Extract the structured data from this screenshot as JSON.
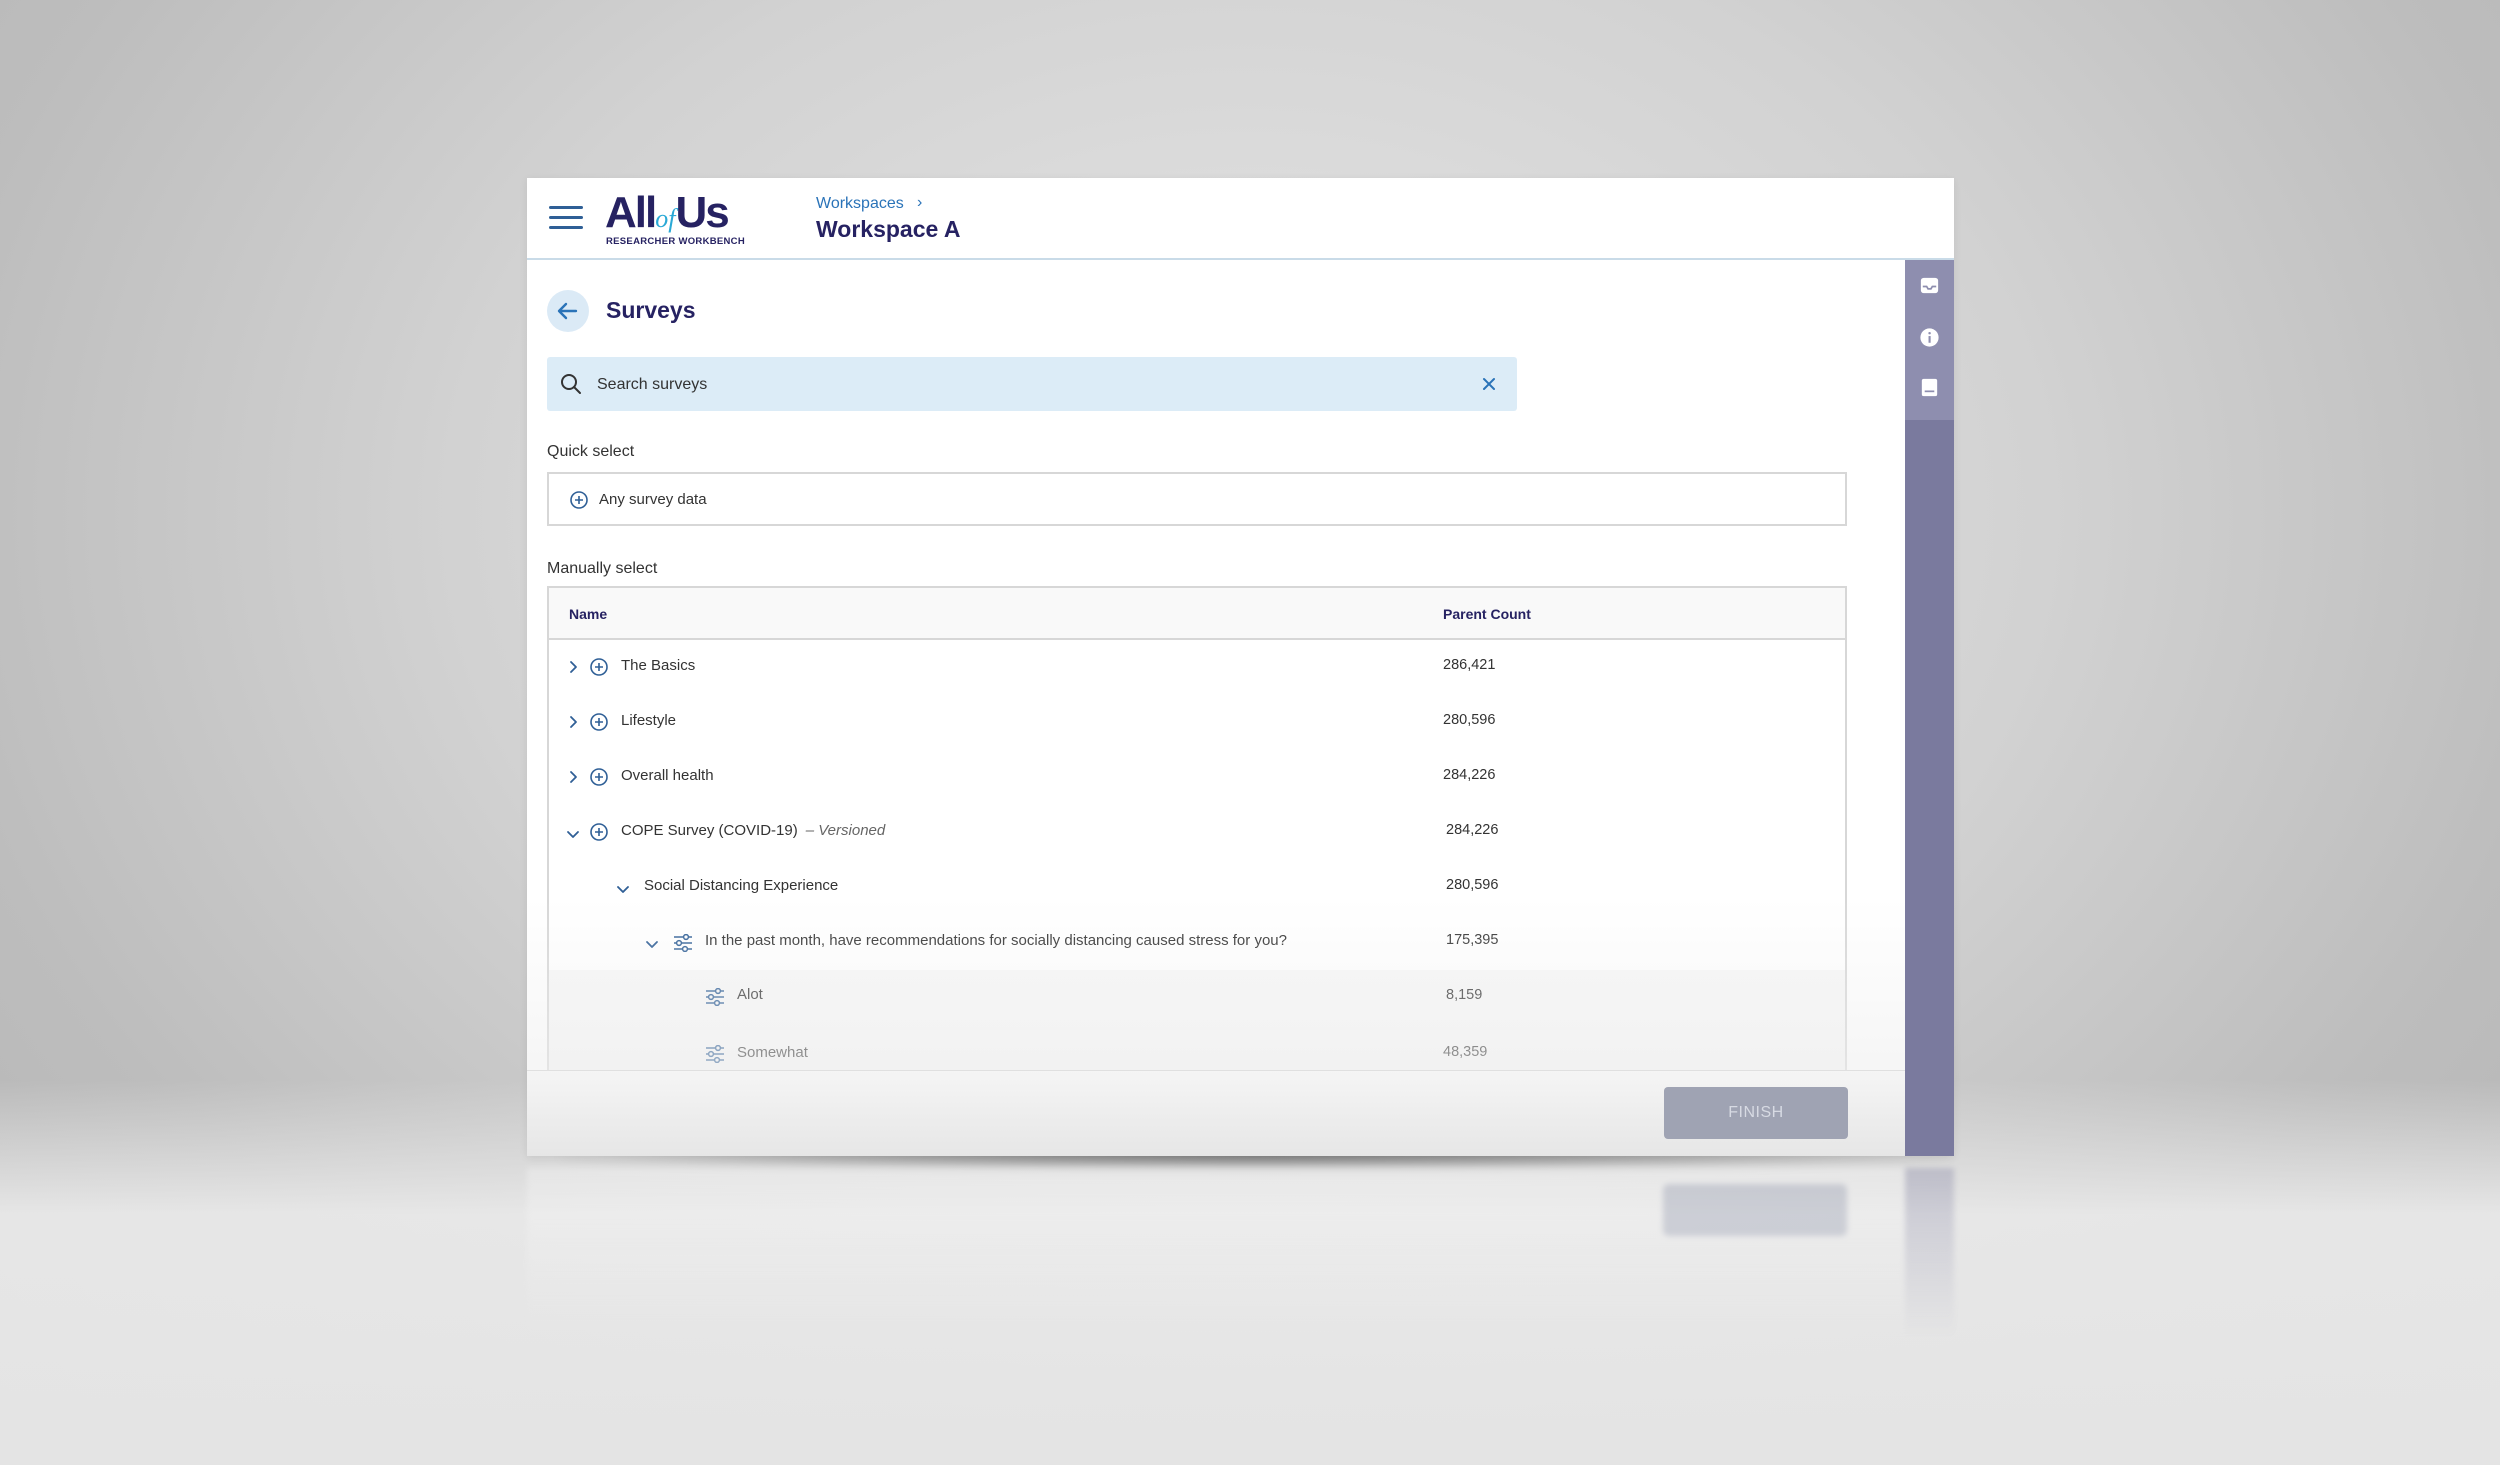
{
  "header": {
    "logo_main": "All",
    "logo_of": "of",
    "logo_us": "Us",
    "logo_sub": "RESEARCHER WORKBENCH",
    "breadcrumb_link": "Workspaces",
    "breadcrumb_sep": "›",
    "workspace_title": "Workspace A"
  },
  "page": {
    "title": "Surveys"
  },
  "search": {
    "placeholder": "Search surveys"
  },
  "quick_select": {
    "label": "Quick select",
    "item": "Any survey data"
  },
  "manual_select": {
    "label": "Manually select",
    "columns": [
      "Name",
      "Parent Count"
    ],
    "rows": [
      {
        "name": "The Basics",
        "count": "286,421"
      },
      {
        "name": "Lifestyle",
        "count": "280,596"
      },
      {
        "name": "Overall health",
        "count": "284,226"
      },
      {
        "name": "COPE Survey (COVID-19)",
        "tag": "– Versioned",
        "count": "284,226"
      },
      {
        "name": "Social Distancing Experience",
        "count": "280,596"
      },
      {
        "name": "In the past month, have recommendations for socially distancing caused stress for you?",
        "count": "175,395"
      },
      {
        "name": "Alot",
        "count": "8,159"
      },
      {
        "name": "Somewhat",
        "count": "48,359"
      }
    ]
  },
  "footer": {
    "finish_label": "FINISH"
  },
  "colors": {
    "brand_navy": "#262262",
    "link_blue": "#2a73b8",
    "search_bg": "#dcecf7",
    "rail": "#7a7a9e"
  },
  "icons": {
    "menu": "hamburger-icon",
    "back": "arrow-left-icon",
    "search": "search-icon",
    "clear": "close-icon",
    "add": "plus-circle-icon",
    "expand": "chevron-right-icon",
    "collapse": "chevron-down-icon",
    "criteria": "sliders-icon",
    "rail": [
      "inbox-icon",
      "info-icon",
      "book-icon"
    ]
  }
}
